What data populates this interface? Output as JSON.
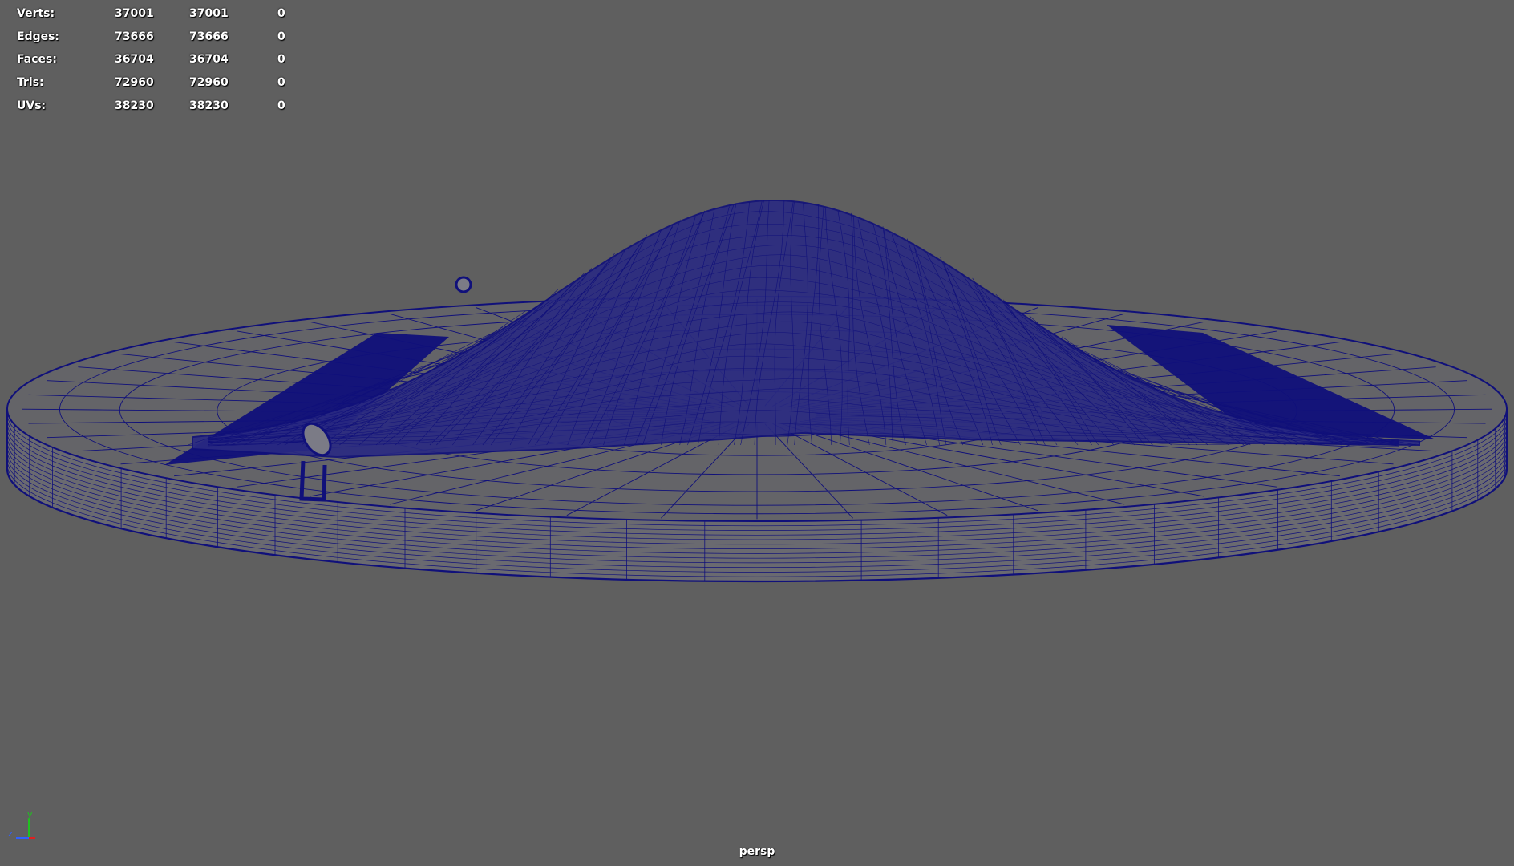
{
  "stats": [
    {
      "label": "Verts:",
      "col1": "37001",
      "col2": "37001",
      "col3": "0"
    },
    {
      "label": "Edges:",
      "col1": "73666",
      "col2": "73666",
      "col3": "0"
    },
    {
      "label": "Faces:",
      "col1": "36704",
      "col2": "36704",
      "col3": "0"
    },
    {
      "label": "Tris:",
      "col1": "72960",
      "col2": "72960",
      "col3": "0"
    },
    {
      "label": "UVs:",
      "col1": "38230",
      "col2": "38230",
      "col3": "0"
    }
  ],
  "camera": {
    "name": "persp"
  },
  "axis": {
    "x": "x",
    "y": "y",
    "z": "z"
  },
  "colors": {
    "background": "#5f5f5f",
    "wireframe": "#10107a",
    "hud_text": "#ffffff",
    "axis_x": "#e02020",
    "axis_y": "#20c020",
    "axis_z": "#3060ff"
  },
  "scene": {
    "objects": [
      "cloth-drape-mesh",
      "disc-base-mesh",
      "pipe-hose-mesh"
    ]
  }
}
